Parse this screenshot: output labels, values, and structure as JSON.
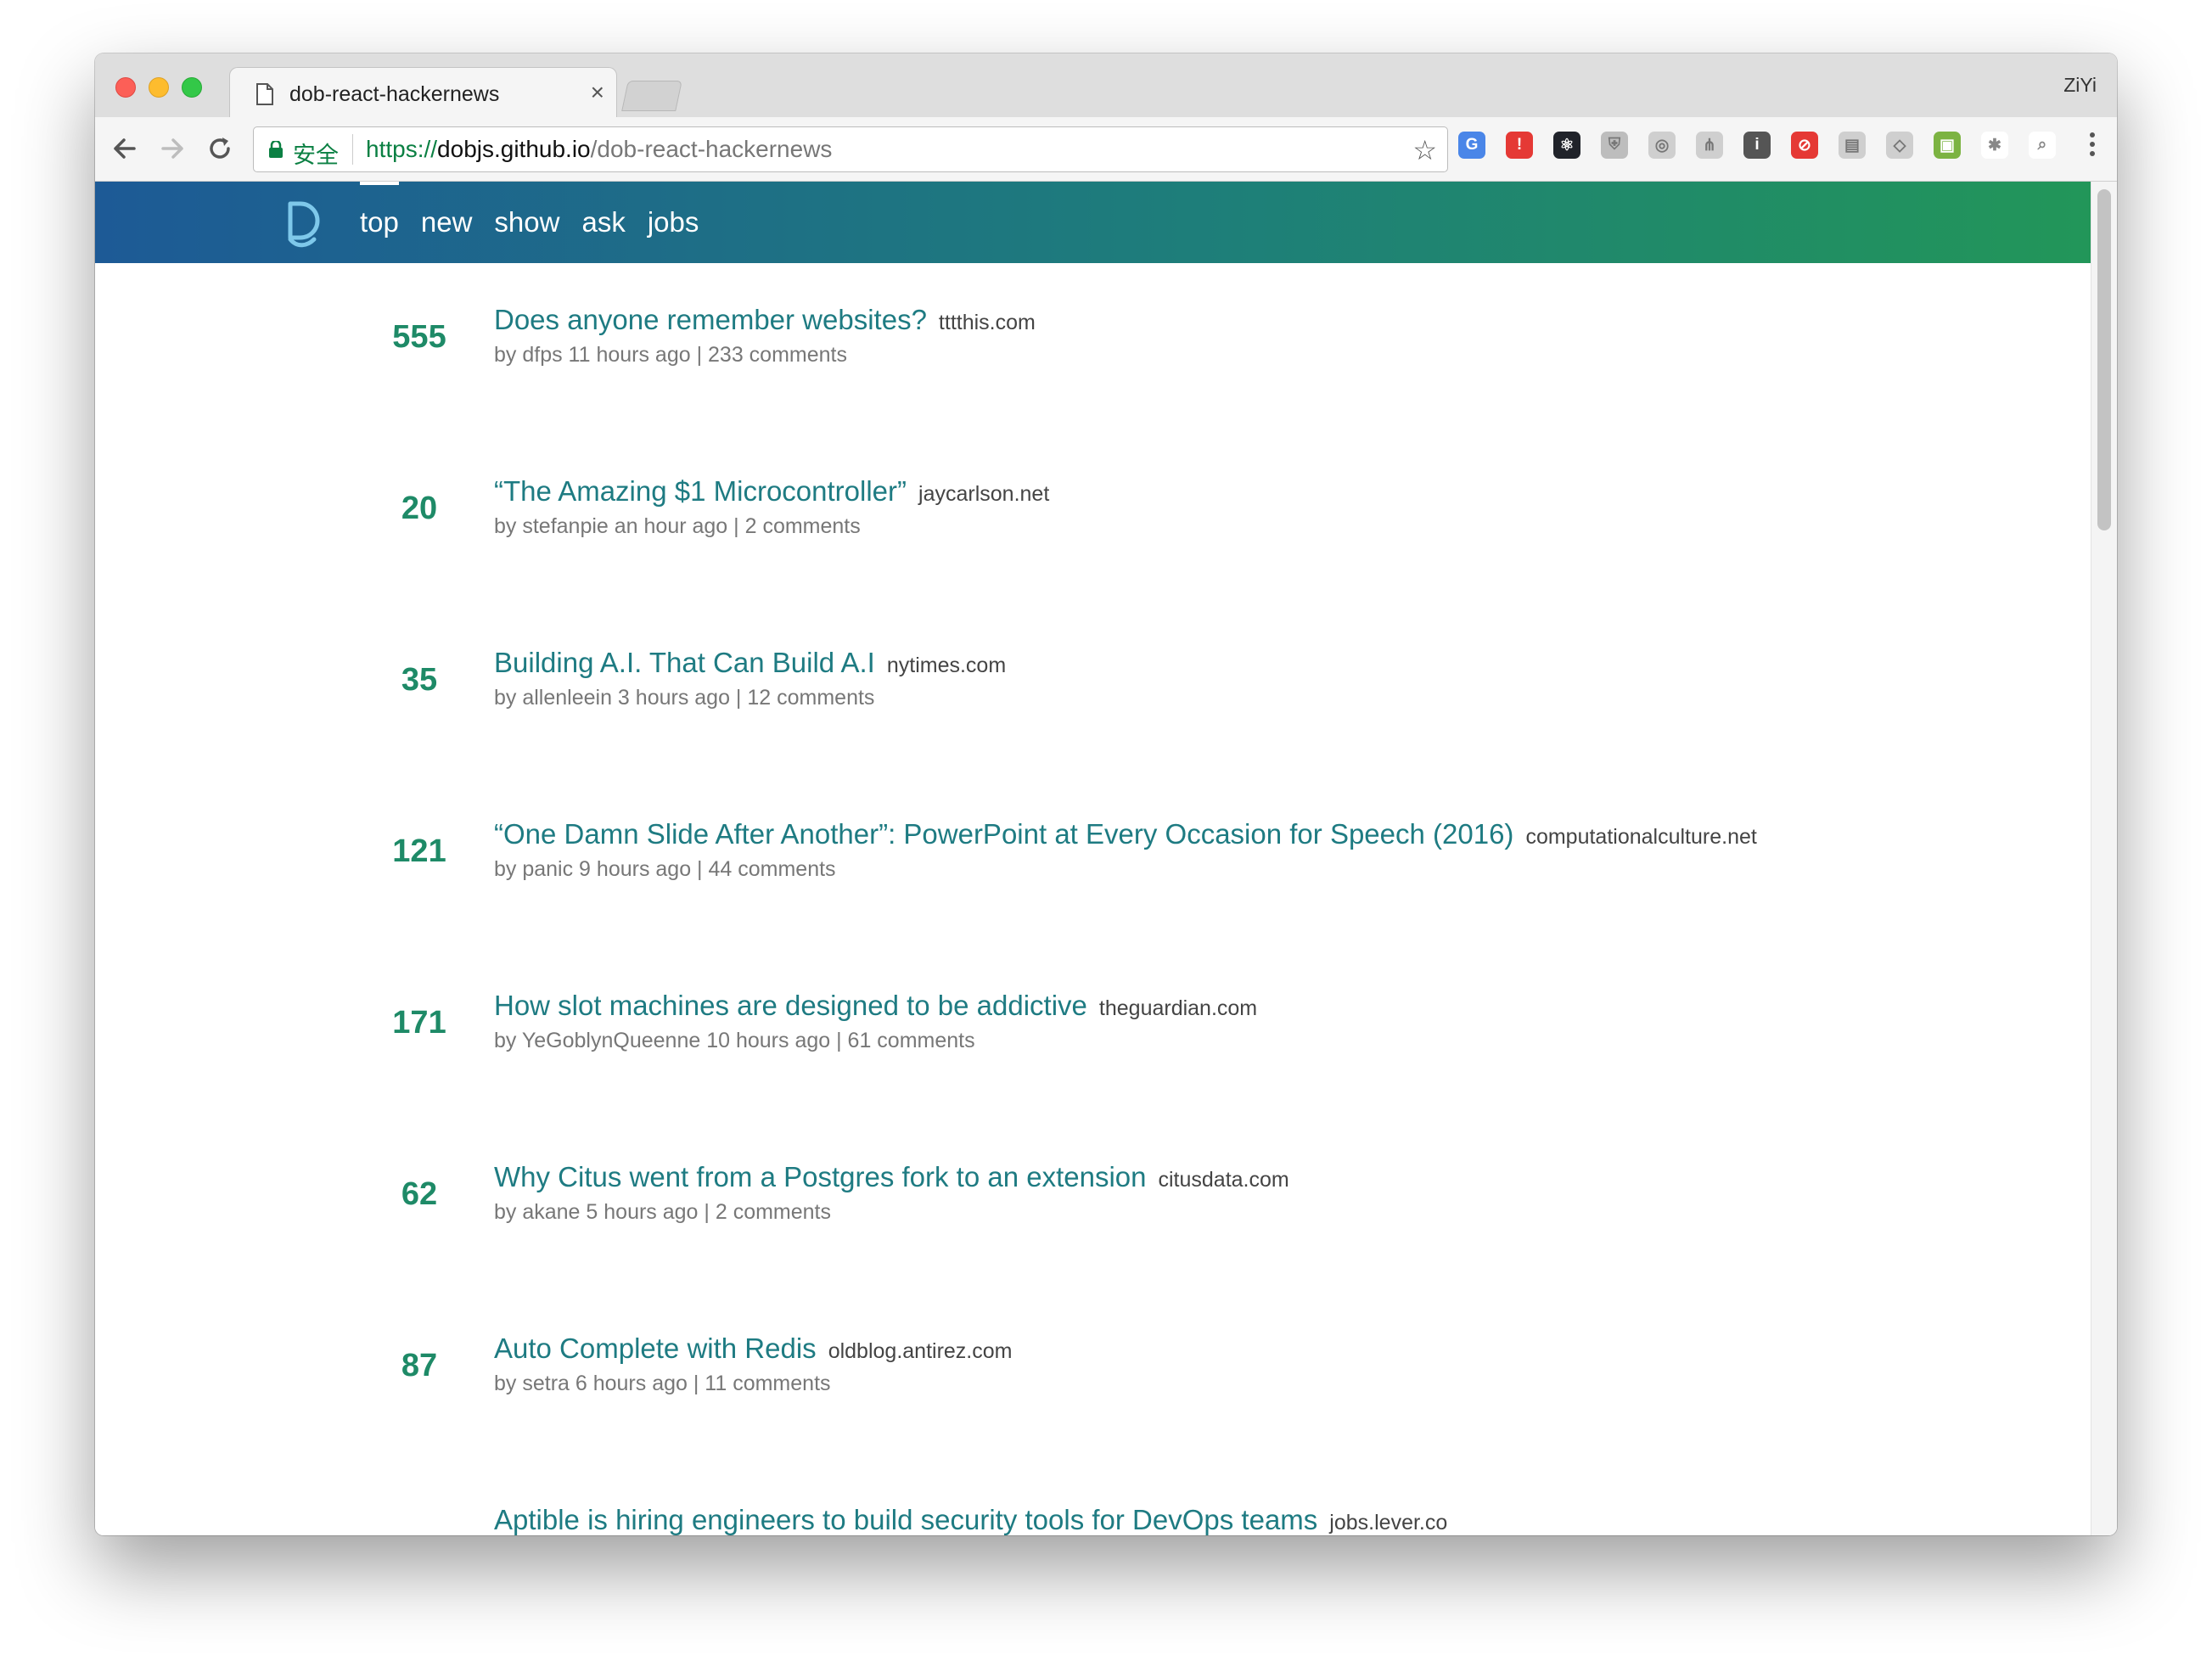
{
  "browser": {
    "tab_title": "dob-react-hackernews",
    "tab_close": "×",
    "profile_name": "ZiYi",
    "security_label": "安全",
    "url_scheme": "https://",
    "url_host": "dobjs.github.io",
    "url_path": "/dob-react-hackernews",
    "bookmark_icon": "☆",
    "extensions": [
      {
        "name": "google-translate-extension-icon",
        "color": "#4a86e8",
        "glyph": "G"
      },
      {
        "name": "adblock-extension-icon",
        "color": "#e53935",
        "glyph": "!"
      },
      {
        "name": "react-devtools-extension-icon",
        "color": "#20232a",
        "glyph": "⚛"
      },
      {
        "name": "shield-extension-icon",
        "color": "#bdbdbd",
        "glyph": "⛨"
      },
      {
        "name": "target-extension-icon",
        "color": "#cfcfcf",
        "glyph": "◎"
      },
      {
        "name": "tree-extension-icon",
        "color": "#cfcfcf",
        "glyph": "⋔"
      },
      {
        "name": "info-extension-icon",
        "color": "#555555",
        "glyph": "i"
      },
      {
        "name": "block-extension-icon",
        "color": "#e53935",
        "glyph": "⊘"
      },
      {
        "name": "layout-extension-icon",
        "color": "#cfcfcf",
        "glyph": "▤"
      },
      {
        "name": "compass-extension-icon",
        "color": "#cfcfcf",
        "glyph": "◇"
      },
      {
        "name": "screenshot-extension-icon",
        "color": "#7cb342",
        "glyph": "▣"
      },
      {
        "name": "pinwheel-extension-icon",
        "color": "#ffffff",
        "glyph": "✱"
      },
      {
        "name": "search-extension-icon",
        "color": "#ffffff",
        "glyph": "⌕"
      }
    ]
  },
  "header": {
    "nav": [
      {
        "label": "top",
        "active": true
      },
      {
        "label": "new",
        "active": false
      },
      {
        "label": "show",
        "active": false
      },
      {
        "label": "ask",
        "active": false
      },
      {
        "label": "jobs",
        "active": false
      }
    ]
  },
  "news": [
    {
      "score": "555",
      "title": "Does anyone remember websites?",
      "domain": "tttthis.com",
      "meta": "by dfps 11 hours ago | 233 comments"
    },
    {
      "score": "20",
      "title": "“The Amazing $1 Microcontroller”",
      "domain": "jaycarlson.net",
      "meta": "by stefanpie an hour ago | 2 comments"
    },
    {
      "score": "35",
      "title": "Building A.I. That Can Build A.I",
      "domain": "nytimes.com",
      "meta": "by allenleein 3 hours ago | 12 comments"
    },
    {
      "score": "121",
      "title": "“One Damn Slide After Another”: PowerPoint at Every Occasion for Speech (2016)",
      "domain": "computationalculture.net",
      "meta": "by panic 9 hours ago | 44 comments"
    },
    {
      "score": "171",
      "title": "How slot machines are designed to be addictive",
      "domain": "theguardian.com",
      "meta": "by YeGoblynQueenne 10 hours ago | 61 comments"
    },
    {
      "score": "62",
      "title": "Why Citus went from a Postgres fork to an extension",
      "domain": "citusdata.com",
      "meta": "by akane 5 hours ago | 2 comments"
    },
    {
      "score": "87",
      "title": "Auto Complete with Redis",
      "domain": "oldblog.antirez.com",
      "meta": "by setra 6 hours ago | 11 comments"
    },
    {
      "score": "",
      "title": "Aptible is hiring engineers to build security tools for DevOps teams",
      "domain": "jobs.lever.co",
      "meta": ""
    }
  ]
}
